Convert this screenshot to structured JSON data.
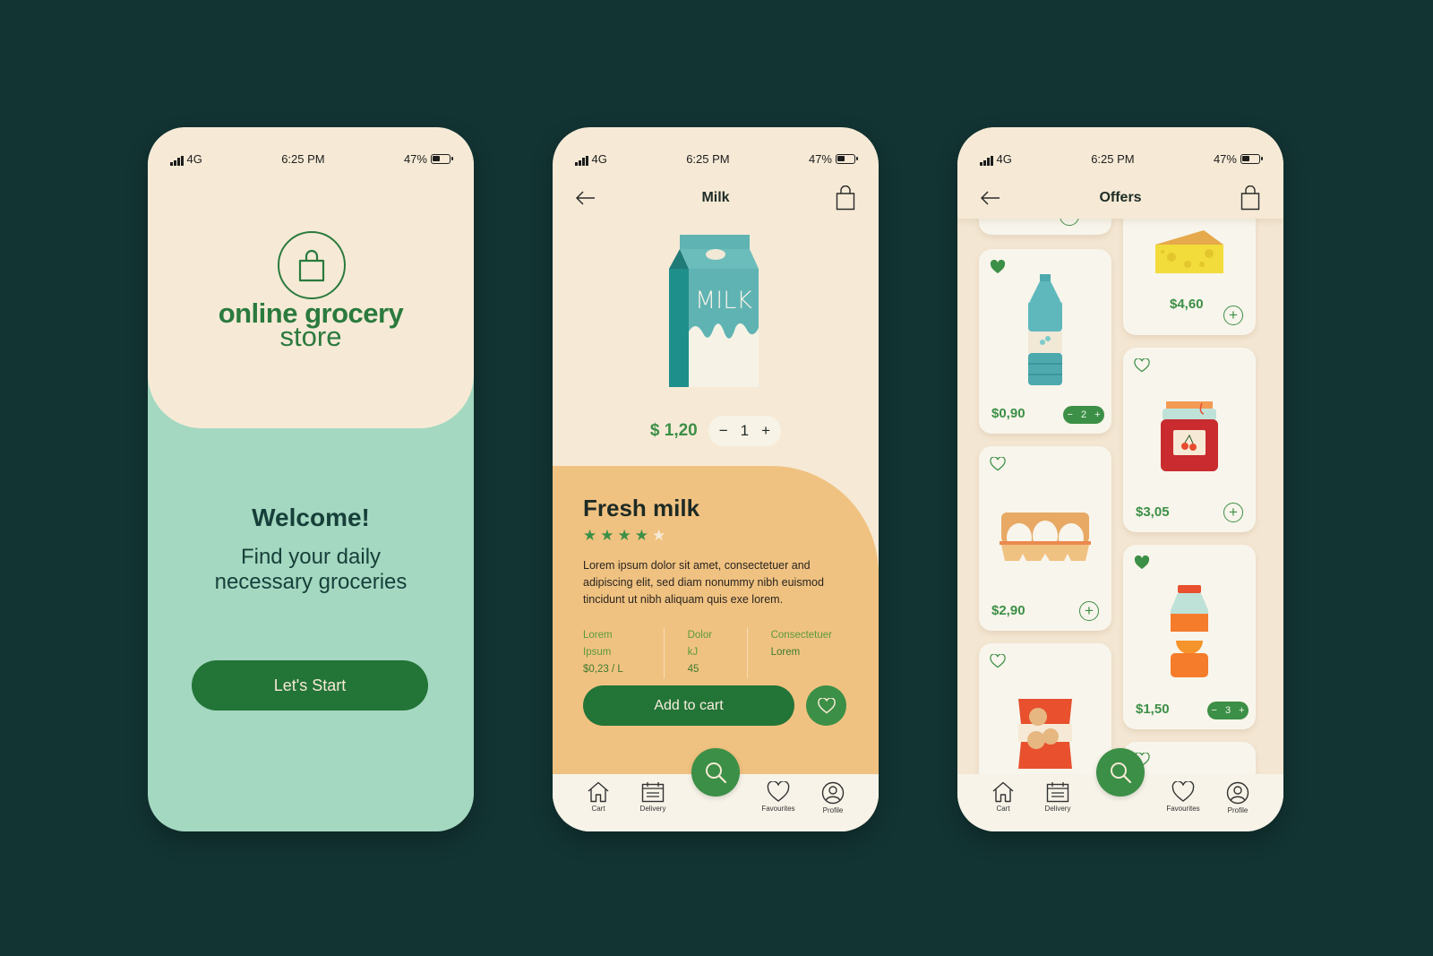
{
  "status_bar": {
    "signal": "4G",
    "time": "6:25 PM",
    "battery": "47%"
  },
  "welcome_screen": {
    "brand_line1": "online grocery",
    "brand_line2": "store",
    "welcome_title": "Welcome!",
    "tagline_line1": "Find your daily",
    "tagline_line2": "necessary groceries",
    "start_button": "Let's Start"
  },
  "product_screen": {
    "title": "Milk",
    "price": "$ 1,20",
    "quantity": "1",
    "minus": "−",
    "plus": "+",
    "product_name": "Fresh milk",
    "rating": 4,
    "rating_max": 5,
    "description": "Lorem ipsum dolor sit amet, consectetuer and adipiscing elit, sed diam nonummy nibh euismod tincidunt ut nibh aliquam quis exe lorem.",
    "specs": [
      {
        "label": "Lorem Ipsum",
        "value": "$0,23 / L"
      },
      {
        "label": "Dolor kJ",
        "value": "45"
      },
      {
        "label": "Consectetuer",
        "value": "Lorem"
      }
    ],
    "add_to_cart": "Add to cart"
  },
  "offers_screen": {
    "title": "Offers",
    "items": [
      {
        "name": "Water bottle",
        "price": "$0,90",
        "favourite": true,
        "quantity": "2"
      },
      {
        "name": "Cheese",
        "price": "$4,60",
        "favourite": false,
        "quantity": null
      },
      {
        "name": "Eggs",
        "price": "$2,90",
        "favourite": false,
        "quantity": null
      },
      {
        "name": "Cherry jam",
        "price": "$3,05",
        "favourite": false,
        "quantity": null
      },
      {
        "name": "Chips",
        "price": "",
        "favourite": false,
        "quantity": null
      },
      {
        "name": "Orange juice",
        "price": "$1,50",
        "favourite": true,
        "quantity": "3"
      }
    ]
  },
  "bottom_nav": [
    {
      "label": "Cart",
      "icon": "home-icon"
    },
    {
      "label": "Delivery",
      "icon": "calendar-icon"
    },
    {
      "label": "Favourites",
      "icon": "heart-icon"
    },
    {
      "label": "Profile",
      "icon": "profile-icon"
    }
  ],
  "colors": {
    "background": "#123433",
    "primary_green": "#237437",
    "accent_green": "#3c8f46",
    "cream": "#f6ead6",
    "mint": "#a4d8c1",
    "orange_panel": "#f0c281"
  }
}
